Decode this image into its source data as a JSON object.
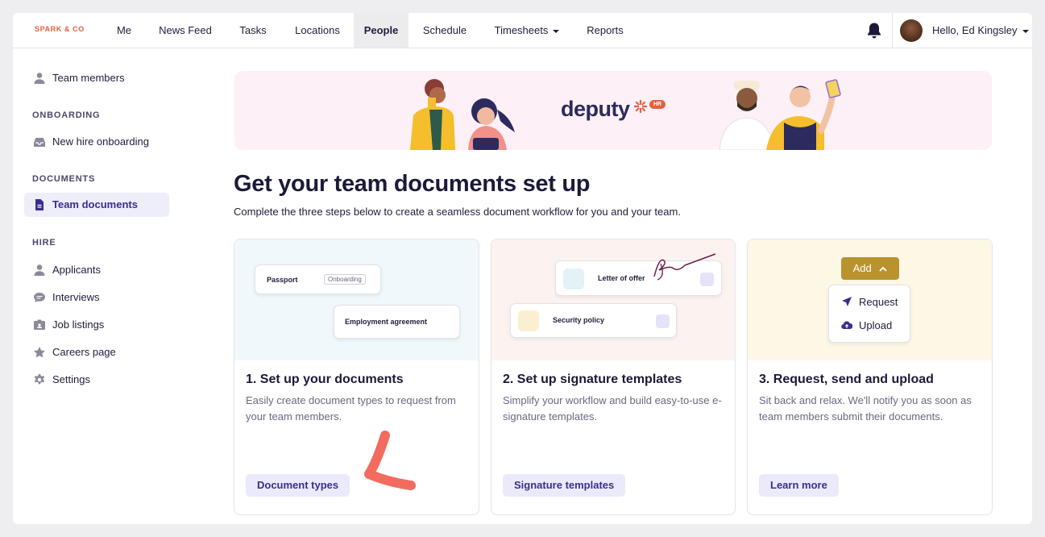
{
  "brand": {
    "name": "SPARK & CO",
    "color": "#e5603e"
  },
  "nav": {
    "items": [
      {
        "label": "Me"
      },
      {
        "label": "News Feed"
      },
      {
        "label": "Tasks"
      },
      {
        "label": "Locations"
      },
      {
        "label": "People",
        "active": true
      },
      {
        "label": "Schedule"
      },
      {
        "label": "Timesheets",
        "dropdown": true
      },
      {
        "label": "Reports"
      }
    ],
    "notifications_icon": "bell-icon",
    "user_greeting": "Hello, Ed Kingsley"
  },
  "sidebar": {
    "top_item": {
      "label": "Team members",
      "icon": "person-icon"
    },
    "sections": [
      {
        "title": "ONBOARDING",
        "items": [
          {
            "label": "New hire onboarding",
            "icon": "inbox-icon"
          }
        ]
      },
      {
        "title": "DOCUMENTS",
        "items": [
          {
            "label": "Team documents",
            "icon": "document-icon",
            "active": true
          }
        ]
      },
      {
        "title": "HIRE",
        "items": [
          {
            "label": "Applicants",
            "icon": "person-icon"
          },
          {
            "label": "Interviews",
            "icon": "chat-icon"
          },
          {
            "label": "Job listings",
            "icon": "id-card-icon"
          },
          {
            "label": "Careers page",
            "icon": "star-icon"
          },
          {
            "label": "Settings",
            "icon": "gear-icon"
          }
        ]
      }
    ]
  },
  "banner": {
    "logo": "deputy",
    "badge": "HR"
  },
  "main": {
    "title": "Get your team documents set up",
    "subtitle": "Complete the three steps below to create a seamless document workflow for you and your team."
  },
  "cards": [
    {
      "title": "1. Set up your documents",
      "description": "Easily create document types to request from your team members.",
      "button": "Document types",
      "illustration": {
        "doc_a": "Passport",
        "doc_a_tag": "Onboarding",
        "doc_b": "Employment agreement"
      },
      "bg": "#f0f8fb"
    },
    {
      "title": "2. Set up signature templates",
      "description": "Simplify your workflow and build easy-to-use e-signature templates.",
      "button": "Signature templates",
      "illustration": {
        "doc_a": "Letter of offer",
        "doc_b": "Security policy"
      },
      "bg": "#fcf3f1"
    },
    {
      "title": "3. Request, send and upload",
      "description": "Sit back and relax. We'll notify you as soon as team members submit their documents.",
      "button": "Learn more",
      "illustration": {
        "add_label": "Add",
        "menu": [
          {
            "label": "Request",
            "icon": "send-icon"
          },
          {
            "label": "Upload",
            "icon": "cloud-upload-icon"
          }
        ]
      },
      "bg": "#fdf7e6"
    }
  ],
  "colors": {
    "accent": "#3b2d8f",
    "accent_bg": "#ebeafa",
    "annotation": "#f26b5f",
    "add_button": "#b9932e"
  }
}
